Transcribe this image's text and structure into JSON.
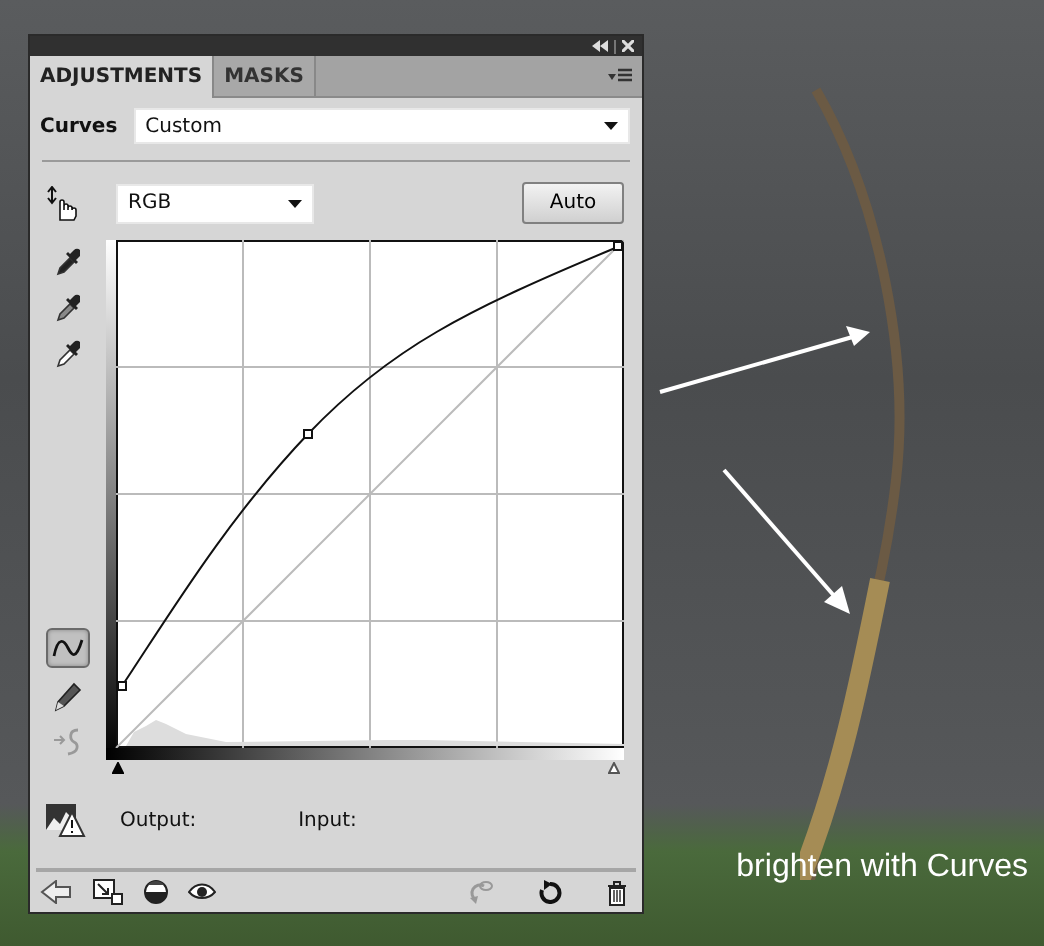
{
  "panel": {
    "tabs": [
      {
        "label": "ADJUSTMENTS",
        "selected": true
      },
      {
        "label": "MASKS",
        "selected": false
      }
    ],
    "preset": {
      "label": "Curves",
      "value": "Custom"
    },
    "channel": {
      "value": "RGB"
    },
    "auto_button": "Auto",
    "edit_modes": [
      {
        "kind": "points",
        "selected": true
      },
      {
        "kind": "pencil",
        "selected": false
      }
    ],
    "smooth": {
      "disabled": true
    },
    "input_sliders": [
      {
        "kind": "shadow",
        "level": 0
      },
      {
        "kind": "highlight",
        "level": 1
      }
    ],
    "output_label": "Output:",
    "input_label": "Input:"
  },
  "caption": "brighten with Curves"
}
